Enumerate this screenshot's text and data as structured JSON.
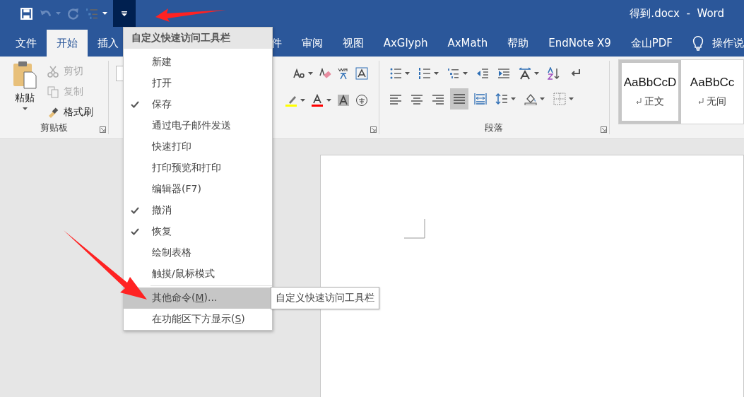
{
  "title_bar": {
    "quick_access": [
      {
        "kind": "save",
        "disabled": false,
        "dropdown": false
      },
      {
        "kind": "undo",
        "disabled": true,
        "dropdown": true
      },
      {
        "kind": "redo",
        "disabled": true,
        "dropdown": false
      },
      {
        "kind": "multilevel",
        "disabled": false,
        "dropdown": true
      }
    ],
    "customize_button": {
      "selected": true
    },
    "title": "得到.docx  -  Word"
  },
  "tabs": [
    {
      "label": "文件",
      "selected": false
    },
    {
      "label": "开始",
      "selected": true
    },
    {
      "label": "插入",
      "selected": false
    },
    {
      "label": "件",
      "selected": false
    },
    {
      "label": "审阅",
      "selected": false
    },
    {
      "label": "视图",
      "selected": false
    },
    {
      "label": "AxGlyph",
      "selected": false
    },
    {
      "label": "AxMath",
      "selected": false
    },
    {
      "label": "帮助",
      "selected": false
    },
    {
      "label": "EndNote X9",
      "selected": false
    },
    {
      "label": "金山PDF",
      "selected": false
    }
  ],
  "tell_me": {
    "text": "操作说"
  },
  "ribbon": {
    "clipboard": {
      "paste": {
        "label": "粘贴"
      },
      "buttons": [
        {
          "kind": "cut",
          "label": "剪切",
          "disabled": true
        },
        {
          "kind": "copy",
          "label": "复制",
          "disabled": true
        },
        {
          "kind": "format_painter",
          "label": "格式刷",
          "disabled": false
        }
      ],
      "label": "剪贴板"
    },
    "font": {
      "row_1": [
        {
          "kind": "change_case",
          "dropdown": true
        },
        {
          "kind": "clear_format",
          "dropdown": false
        },
        {
          "kind": "phonetic",
          "dropdown": false
        },
        {
          "kind": "char_border",
          "dropdown": false
        }
      ],
      "row_2": [
        {
          "kind": "highlight",
          "dropdown": true
        },
        {
          "kind": "font_color",
          "dropdown": true
        },
        {
          "kind": "char_shading",
          "dropdown": false
        },
        {
          "kind": "enclose",
          "dropdown": false
        }
      ]
    },
    "paragraph": {
      "row_1": [
        {
          "kind": "bullets",
          "dropdown": true,
          "selected": false
        },
        {
          "kind": "numbering",
          "dropdown": true,
          "selected": false
        },
        {
          "kind": "multilevel",
          "dropdown": true,
          "selected": false
        },
        {
          "kind": "outdent",
          "dropdown": false,
          "selected": false
        },
        {
          "kind": "indent",
          "dropdown": false,
          "selected": false
        },
        {
          "kind": "asian_layout",
          "dropdown": true,
          "selected": false
        },
        {
          "kind": "sort",
          "dropdown": false,
          "selected": false
        },
        {
          "kind": "show_marks",
          "dropdown": false,
          "selected": false
        }
      ],
      "row_2": [
        {
          "kind": "align_left",
          "dropdown": false,
          "selected": false
        },
        {
          "kind": "align_center",
          "dropdown": false,
          "selected": false
        },
        {
          "kind": "align_right",
          "dropdown": false,
          "selected": false
        },
        {
          "kind": "justify",
          "dropdown": false,
          "selected": true
        },
        {
          "kind": "distribute",
          "dropdown": false,
          "selected": false
        },
        {
          "kind": "line_spacing",
          "dropdown": true,
          "selected": false
        },
        {
          "kind": "shading",
          "dropdown": true,
          "selected": false
        },
        {
          "kind": "borders",
          "dropdown": true,
          "selected": false
        }
      ],
      "label": "段落"
    },
    "styles": [
      {
        "sample": "AaBbCcD",
        "name": "正文",
        "selected": true
      },
      {
        "sample": "AaBbCc",
        "name": "无间",
        "selected": false
      }
    ]
  },
  "menu": {
    "header": "自定义快速访问工具栏",
    "items": [
      {
        "kind": "item",
        "label_parts": [
          "新建"
        ],
        "checked": false,
        "selected": false
      },
      {
        "kind": "item",
        "label_parts": [
          "打开"
        ],
        "checked": false,
        "selected": false
      },
      {
        "kind": "item",
        "label_parts": [
          "保存"
        ],
        "checked": true,
        "selected": false
      },
      {
        "kind": "item",
        "label_parts": [
          "通过电子邮件发送"
        ],
        "checked": false,
        "selected": false
      },
      {
        "kind": "item",
        "label_parts": [
          "快速打印"
        ],
        "checked": false,
        "selected": false
      },
      {
        "kind": "item",
        "label_parts": [
          "打印预览和打印"
        ],
        "checked": false,
        "selected": false
      },
      {
        "kind": "item",
        "label_parts": [
          "编辑器(F7)"
        ],
        "checked": false,
        "selected": false
      },
      {
        "kind": "item",
        "label_parts": [
          "撤消"
        ],
        "checked": true,
        "selected": false
      },
      {
        "kind": "item",
        "label_parts": [
          "恢复"
        ],
        "checked": true,
        "selected": false
      },
      {
        "kind": "item",
        "label_parts": [
          "绘制表格"
        ],
        "checked": false,
        "selected": false
      },
      {
        "kind": "item",
        "label_parts": [
          "触摸/鼠标模式"
        ],
        "checked": false,
        "selected": false
      },
      {
        "kind": "separator"
      },
      {
        "kind": "item",
        "label_parts": [
          "其他命令(",
          "M",
          ")..."
        ],
        "checked": false,
        "selected": true
      },
      {
        "kind": "item",
        "label_parts": [
          "在功能区下方显示(",
          "S",
          ")"
        ],
        "checked": false,
        "selected": false
      }
    ]
  },
  "tooltip": {
    "text": "自定义快速访问工具栏"
  },
  "annotations": [
    {
      "kind": "arrow"
    },
    {
      "kind": "arrow"
    }
  ]
}
